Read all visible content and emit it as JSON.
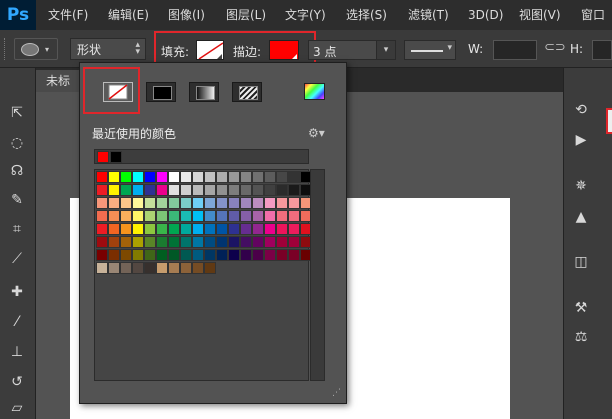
{
  "app": {
    "logo": "Ps"
  },
  "menu": [
    "文件(F)",
    "编辑(E)",
    "图像(I)",
    "图层(L)",
    "文字(Y)",
    "选择(S)",
    "滤镜(T)",
    "3D(D)",
    "视图(V)",
    "窗口"
  ],
  "options": {
    "shape_mode": "形状",
    "fill_label": "填充:",
    "stroke_label": "描边:",
    "stroke_width": "3 点",
    "w_label": "W:",
    "h_label": "H:"
  },
  "document": {
    "tab_title": "未标"
  },
  "popup": {
    "recent_title": "最近使用的颜色",
    "recent_colors": [
      "#ff0000",
      "#000000"
    ],
    "swatch_rows": [
      [
        "#ff0000",
        "#ffff00",
        "#00ff00",
        "#00ffff",
        "#0000ff",
        "#ff00ff",
        "#ffffff",
        "#ebebeb",
        "#d6d6d6",
        "#c2c2c2",
        "#adadad",
        "#999999",
        "#858585",
        "#707070",
        "#5c5c5c",
        "#474747",
        "#333333",
        "#000000"
      ],
      [
        "#ed1c24",
        "#fff200",
        "#00a651",
        "#00aeef",
        "#2e3192",
        "#ec008c",
        "#e1e1e1",
        "#cfcfcf",
        "#bababa",
        "#a6a6a6",
        "#919191",
        "#7d7d7d",
        "#696969",
        "#545454",
        "#404040",
        "#2b2b2b",
        "#1a1a1a",
        "#0d0d0d"
      ],
      [
        "#f7977a",
        "#f9ad81",
        "#fdc68a",
        "#fff79a",
        "#c4df9b",
        "#a2d39c",
        "#82ca9d",
        "#7bcdc8",
        "#6ecff6",
        "#7ea7d8",
        "#8493ca",
        "#8882be",
        "#a187be",
        "#bc8dbf",
        "#f49ac2",
        "#f6989d",
        "#f5989d",
        "#f69679"
      ],
      [
        "#f26c4f",
        "#f68e55",
        "#fbaf5c",
        "#fff467",
        "#acd372",
        "#7cc576",
        "#3bb878",
        "#1abbb4",
        "#00bff3",
        "#438cca",
        "#5574b9",
        "#605ca8",
        "#855fa8",
        "#a763a8",
        "#f06eaa",
        "#f26d7d",
        "#f26c7d",
        "#f06c5c"
      ],
      [
        "#ed1c24",
        "#f26522",
        "#f7941d",
        "#fff200",
        "#8dc73f",
        "#39b54a",
        "#00a651",
        "#00a99d",
        "#00aeef",
        "#0072bc",
        "#0054a6",
        "#2e3192",
        "#662d91",
        "#92278f",
        "#ec008c",
        "#ed145b",
        "#ed1c5c",
        "#e1111e"
      ],
      [
        "#9e0b0f",
        "#a0410d",
        "#a36209",
        "#aba000",
        "#598527",
        "#1a7b30",
        "#007236",
        "#00746b",
        "#0076a3",
        "#004b80",
        "#003471",
        "#1b1464",
        "#440e62",
        "#630460",
        "#9e005d",
        "#9e0039",
        "#9e0039",
        "#8e0b0f"
      ],
      [
        "#790000",
        "#7b2e00",
        "#7d4900",
        "#827b00",
        "#406618",
        "#005e20",
        "#005826",
        "#005952",
        "#005b7f",
        "#003663",
        "#002157",
        "#0d004c",
        "#32004b",
        "#4b0049",
        "#7b0046",
        "#7a0026",
        "#7a0026",
        "#6a0000"
      ],
      [
        "#c7b299",
        "#998675",
        "#736357",
        "#534741",
        "#37302d",
        "#c69c6d",
        "#a67c52",
        "#8c6239",
        "#754c24",
        "#603913"
      ]
    ]
  }
}
